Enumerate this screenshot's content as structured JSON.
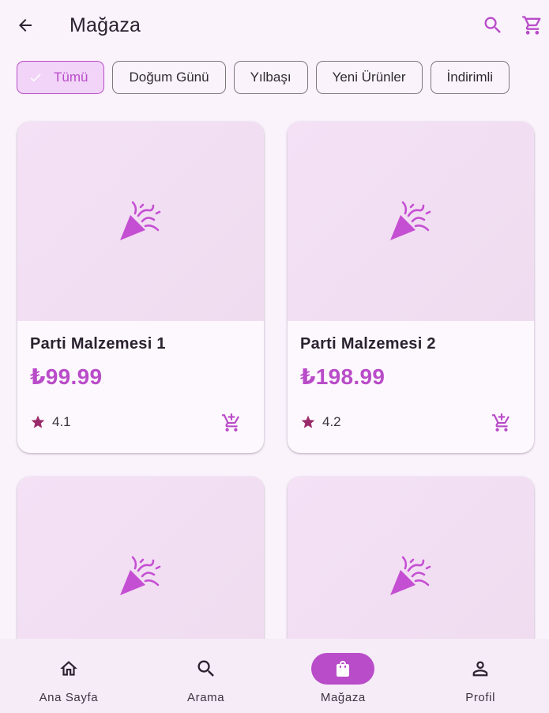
{
  "appbar": {
    "title": "Mağaza",
    "back_icon": "arrow-back-icon",
    "search_icon": "search-icon",
    "cart_icon": "shopping-cart-icon"
  },
  "filters": {
    "selected": "Tümü",
    "chips": [
      {
        "label": "Tümü",
        "selected": true
      },
      {
        "label": "Doğum Günü",
        "selected": false
      },
      {
        "label": "Yılbaşı",
        "selected": false
      },
      {
        "label": "Yeni Ürünler",
        "selected": false
      },
      {
        "label": "İndirimli",
        "selected": false
      }
    ]
  },
  "products": [
    {
      "name": "Parti Malzemesi 1",
      "price": "₺99.99",
      "rating": "4.1",
      "image_icon": "party-popper-icon"
    },
    {
      "name": "Parti Malzemesi 2",
      "price": "₺198.99",
      "rating": "4.2",
      "image_icon": "party-popper-icon"
    },
    {
      "image_icon": "party-popper-icon"
    },
    {
      "image_icon": "party-popper-icon"
    }
  ],
  "bottom_nav": {
    "active": "Mağaza",
    "items": [
      {
        "label": "Ana Sayfa",
        "icon": "home-icon"
      },
      {
        "label": "Arama",
        "icon": "search-icon"
      },
      {
        "label": "Mağaza",
        "icon": "shopping-bag-icon"
      },
      {
        "label": "Profil",
        "icon": "person-icon"
      }
    ]
  },
  "colors": {
    "accent": "#b94cc9",
    "background": "#fbf3fc",
    "star": "#9a2a6a",
    "chip_selected_bg": "#f1d4f7",
    "nav_bg": "#f6ecf8"
  }
}
